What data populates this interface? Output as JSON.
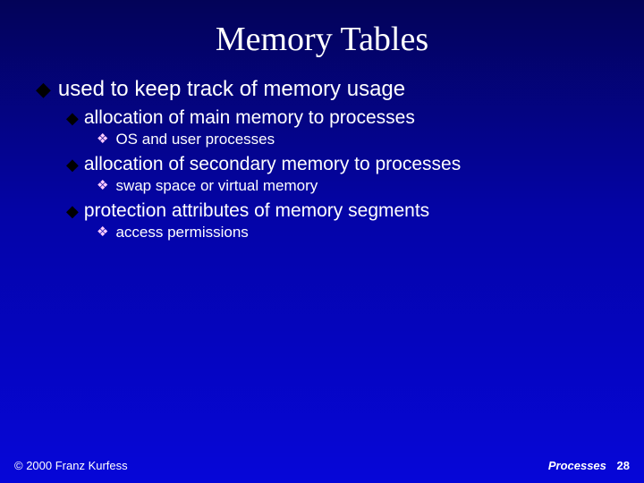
{
  "title": "Memory Tables",
  "bullets": {
    "l1_1": "used to keep track of memory usage",
    "l2_1": "allocation of main memory to processes",
    "l3_1": "OS and user processes",
    "l2_2": "allocation of secondary memory to processes",
    "l3_2": "swap space or virtual memory",
    "l2_3": "protection attributes of memory segments",
    "l3_3": "access permissions"
  },
  "footer": {
    "copyright": "© 2000 Franz Kurfess",
    "section": "Processes",
    "page_number": "28"
  }
}
